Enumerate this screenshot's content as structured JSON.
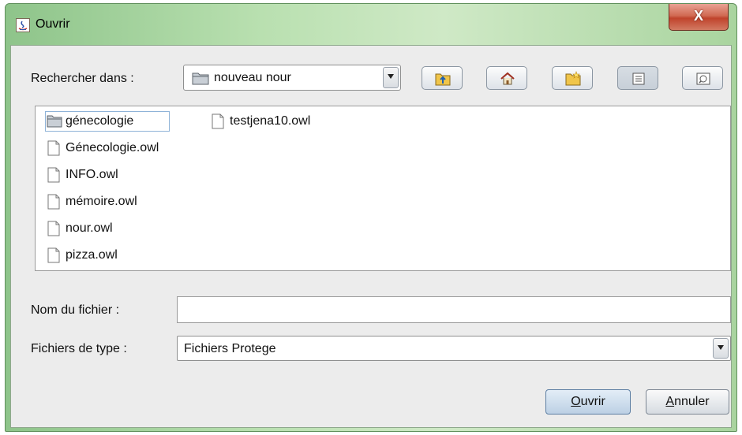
{
  "window": {
    "title": "Ouvrir",
    "close_label": "X"
  },
  "lookin": {
    "label": "Rechercher dans :",
    "value": "nouveau nour"
  },
  "toolbar": {
    "buttons": [
      {
        "name": "up-one-level-icon"
      },
      {
        "name": "home-icon"
      },
      {
        "name": "new-folder-icon"
      },
      {
        "name": "list-view-icon",
        "pressed": true
      },
      {
        "name": "details-view-icon"
      }
    ]
  },
  "files": [
    {
      "name": "génecologie",
      "type": "folder"
    },
    {
      "name": "Génecologie.owl",
      "type": "file"
    },
    {
      "name": "INFO.owl",
      "type": "file"
    },
    {
      "name": "mémoire.owl",
      "type": "file"
    },
    {
      "name": "nour.owl",
      "type": "file"
    },
    {
      "name": "pizza.owl",
      "type": "file"
    },
    {
      "name": "testjena10.owl",
      "type": "file"
    }
  ],
  "filename": {
    "label": "Nom du fichier :",
    "value": ""
  },
  "filetype": {
    "label": "Fichiers de type :",
    "value": "Fichiers Protege"
  },
  "actions": {
    "open_first": "O",
    "open_rest": "uvrir",
    "cancel_first": "A",
    "cancel_rest": "nnuler"
  }
}
